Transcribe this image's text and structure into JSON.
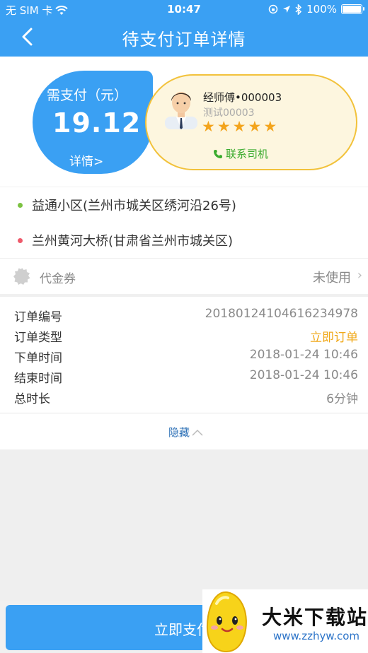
{
  "status": {
    "carrier": "无 SIM 卡",
    "time": "10:47",
    "battery": "100%"
  },
  "nav": {
    "title": "待支付订单详情"
  },
  "payment": {
    "label": "需支付（元）",
    "amount": "19.12",
    "detail_link": "详情>"
  },
  "driver": {
    "name": "经师傅•000003",
    "subtitle": "测试00003",
    "rating_stars": 5,
    "contact_label": "联系司机"
  },
  "addresses": [
    {
      "text": "益通小区(兰州市城关区绣河沿26号)",
      "color": "#7cc242"
    },
    {
      "text": "兰州黄河大桥(甘肃省兰州市城关区)",
      "color": "#ee5a6b"
    }
  ],
  "voucher": {
    "label": "代金券",
    "value": "未使用"
  },
  "order_info": [
    {
      "key": "订单编号",
      "value": "2018012410461623497​8"
    },
    {
      "key": "订单类型",
      "value": "立即订单"
    },
    {
      "key": "下单时间",
      "value": "2018-01-24 10:46"
    },
    {
      "key": "结束时间",
      "value": "2018-01-24 10:46"
    },
    {
      "key": "总时长",
      "value": "6分钟"
    }
  ],
  "toggle": {
    "label": "隐藏"
  },
  "footer": {
    "pay_button": "立即支付"
  },
  "watermark": {
    "title": "大米下载站",
    "url": "www.zzhyw.com"
  },
  "colors": {
    "primary": "#3aa0f3",
    "star": "#f3a41c",
    "accent_order_type": "#f0a818",
    "contact_green": "#3bab2e"
  }
}
